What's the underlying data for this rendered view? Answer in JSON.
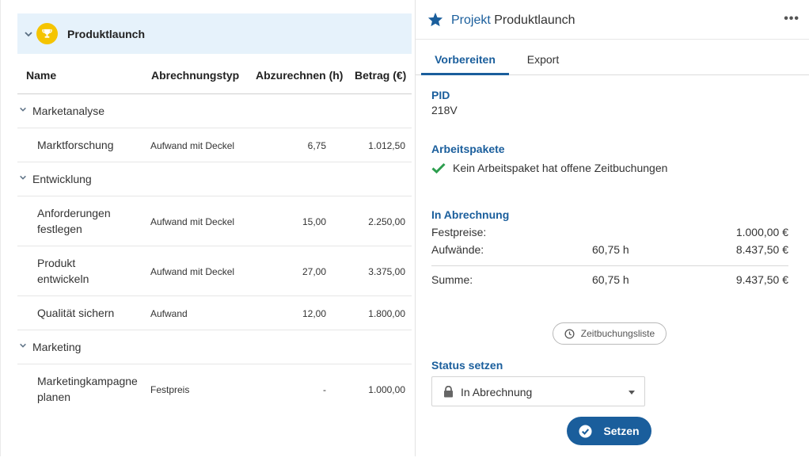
{
  "project": {
    "name": "Produktlaunch"
  },
  "table": {
    "columns": [
      "Name",
      "Abrechnungstyp",
      "Abzurechnen (h)",
      "Betrag (€)"
    ],
    "groups": [
      {
        "name": "Marketanalyse"
      },
      {
        "name": "Entwicklung"
      },
      {
        "name": "Marketing"
      }
    ],
    "rows": [
      {
        "name": "Marktforschung",
        "type": "Aufwand mit Deckel",
        "hours": "6,75",
        "amount": "1.012,50"
      },
      {
        "name": "Anforderungen festlegen",
        "type": "Aufwand mit Deckel",
        "hours": "15,00",
        "amount": "2.250,00"
      },
      {
        "name": "Produkt entwickeln",
        "type": "Aufwand mit Deckel",
        "hours": "27,00",
        "amount": "3.375,00"
      },
      {
        "name": "Qualität sichern",
        "type": "Aufwand",
        "hours": "12,00",
        "amount": "1.800,00"
      },
      {
        "name": "Marketingkampagne planen",
        "type": "Festpreis",
        "hours": "-",
        "amount": "1.000,00"
      }
    ]
  },
  "panel": {
    "title_prefix": "Projekt",
    "title": "Produktlaunch",
    "more": "•••",
    "tabs": [
      "Vorbereiten",
      "Export"
    ],
    "pid_label": "PID",
    "pid_value": "218V",
    "ap_label": "Arbeitspakete",
    "ap_status": "Kein Arbeitspaket hat offene Zeitbuchungen",
    "billing_label": "In Abrechnung",
    "billing": {
      "festpreise_label": "Festpreise:",
      "festpreise_amount": "1.000,00 €",
      "aufwaende_label": "Aufwände:",
      "aufwaende_hours": "60,75 h",
      "aufwaende_amount": "8.437,50 €",
      "summe_label": "Summe:",
      "summe_hours": "60,75 h",
      "summe_amount": "9.437,50 €"
    },
    "zeitbuchungsliste": "Zeitbuchungsliste",
    "status_label": "Status setzen",
    "status_value": "In Abrechnung",
    "set_button": "Setzen"
  },
  "colors": {
    "accent": "#1a5e9c",
    "header_bg": "#e6f2fb",
    "trophy": "#f5c400",
    "check": "#2e9e4f"
  }
}
